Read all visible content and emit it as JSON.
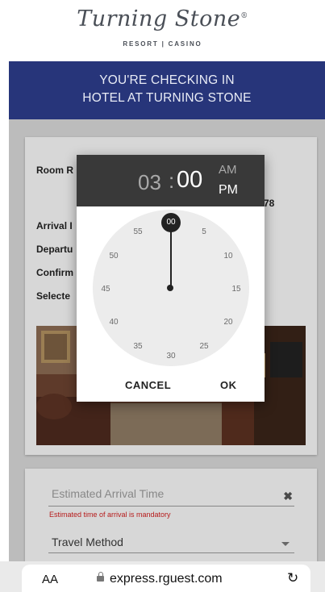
{
  "brand": {
    "name": "Turning Stone",
    "reg": "®",
    "tagline": "RESORT | CASINO"
  },
  "banner": {
    "line1": "YOU'RE CHECKING IN",
    "line2": "HOTEL AT TURNING STONE"
  },
  "reservation": {
    "room_label": "Room R",
    "arrival_label": "Arrival I",
    "departure_label": "Departu",
    "confirmation_label": "Confirm",
    "selected_label": "Selecte",
    "side_value": "78"
  },
  "form": {
    "eta_placeholder": "Estimated Arrival Time",
    "eta_error": "Estimated time of arrival is mandatory",
    "travel_label": "Travel Method"
  },
  "time_picker": {
    "hour": "03",
    "separator": ":",
    "minute": "00",
    "am": "AM",
    "pm": "PM",
    "selected_period": "PM",
    "selected_minute": "00",
    "dial_labels": [
      "00",
      "5",
      "10",
      "15",
      "20",
      "25",
      "30",
      "35",
      "40",
      "45",
      "50",
      "55"
    ],
    "cancel_label": "CANCEL",
    "ok_label": "OK"
  },
  "browser": {
    "text_size": "AA",
    "url": "express.rguest.com",
    "lock_icon": "lock-icon",
    "reload_icon": "reload-icon"
  },
  "colors": {
    "banner": "#27357a",
    "picker_header": "#393939",
    "error": "#d02020"
  }
}
